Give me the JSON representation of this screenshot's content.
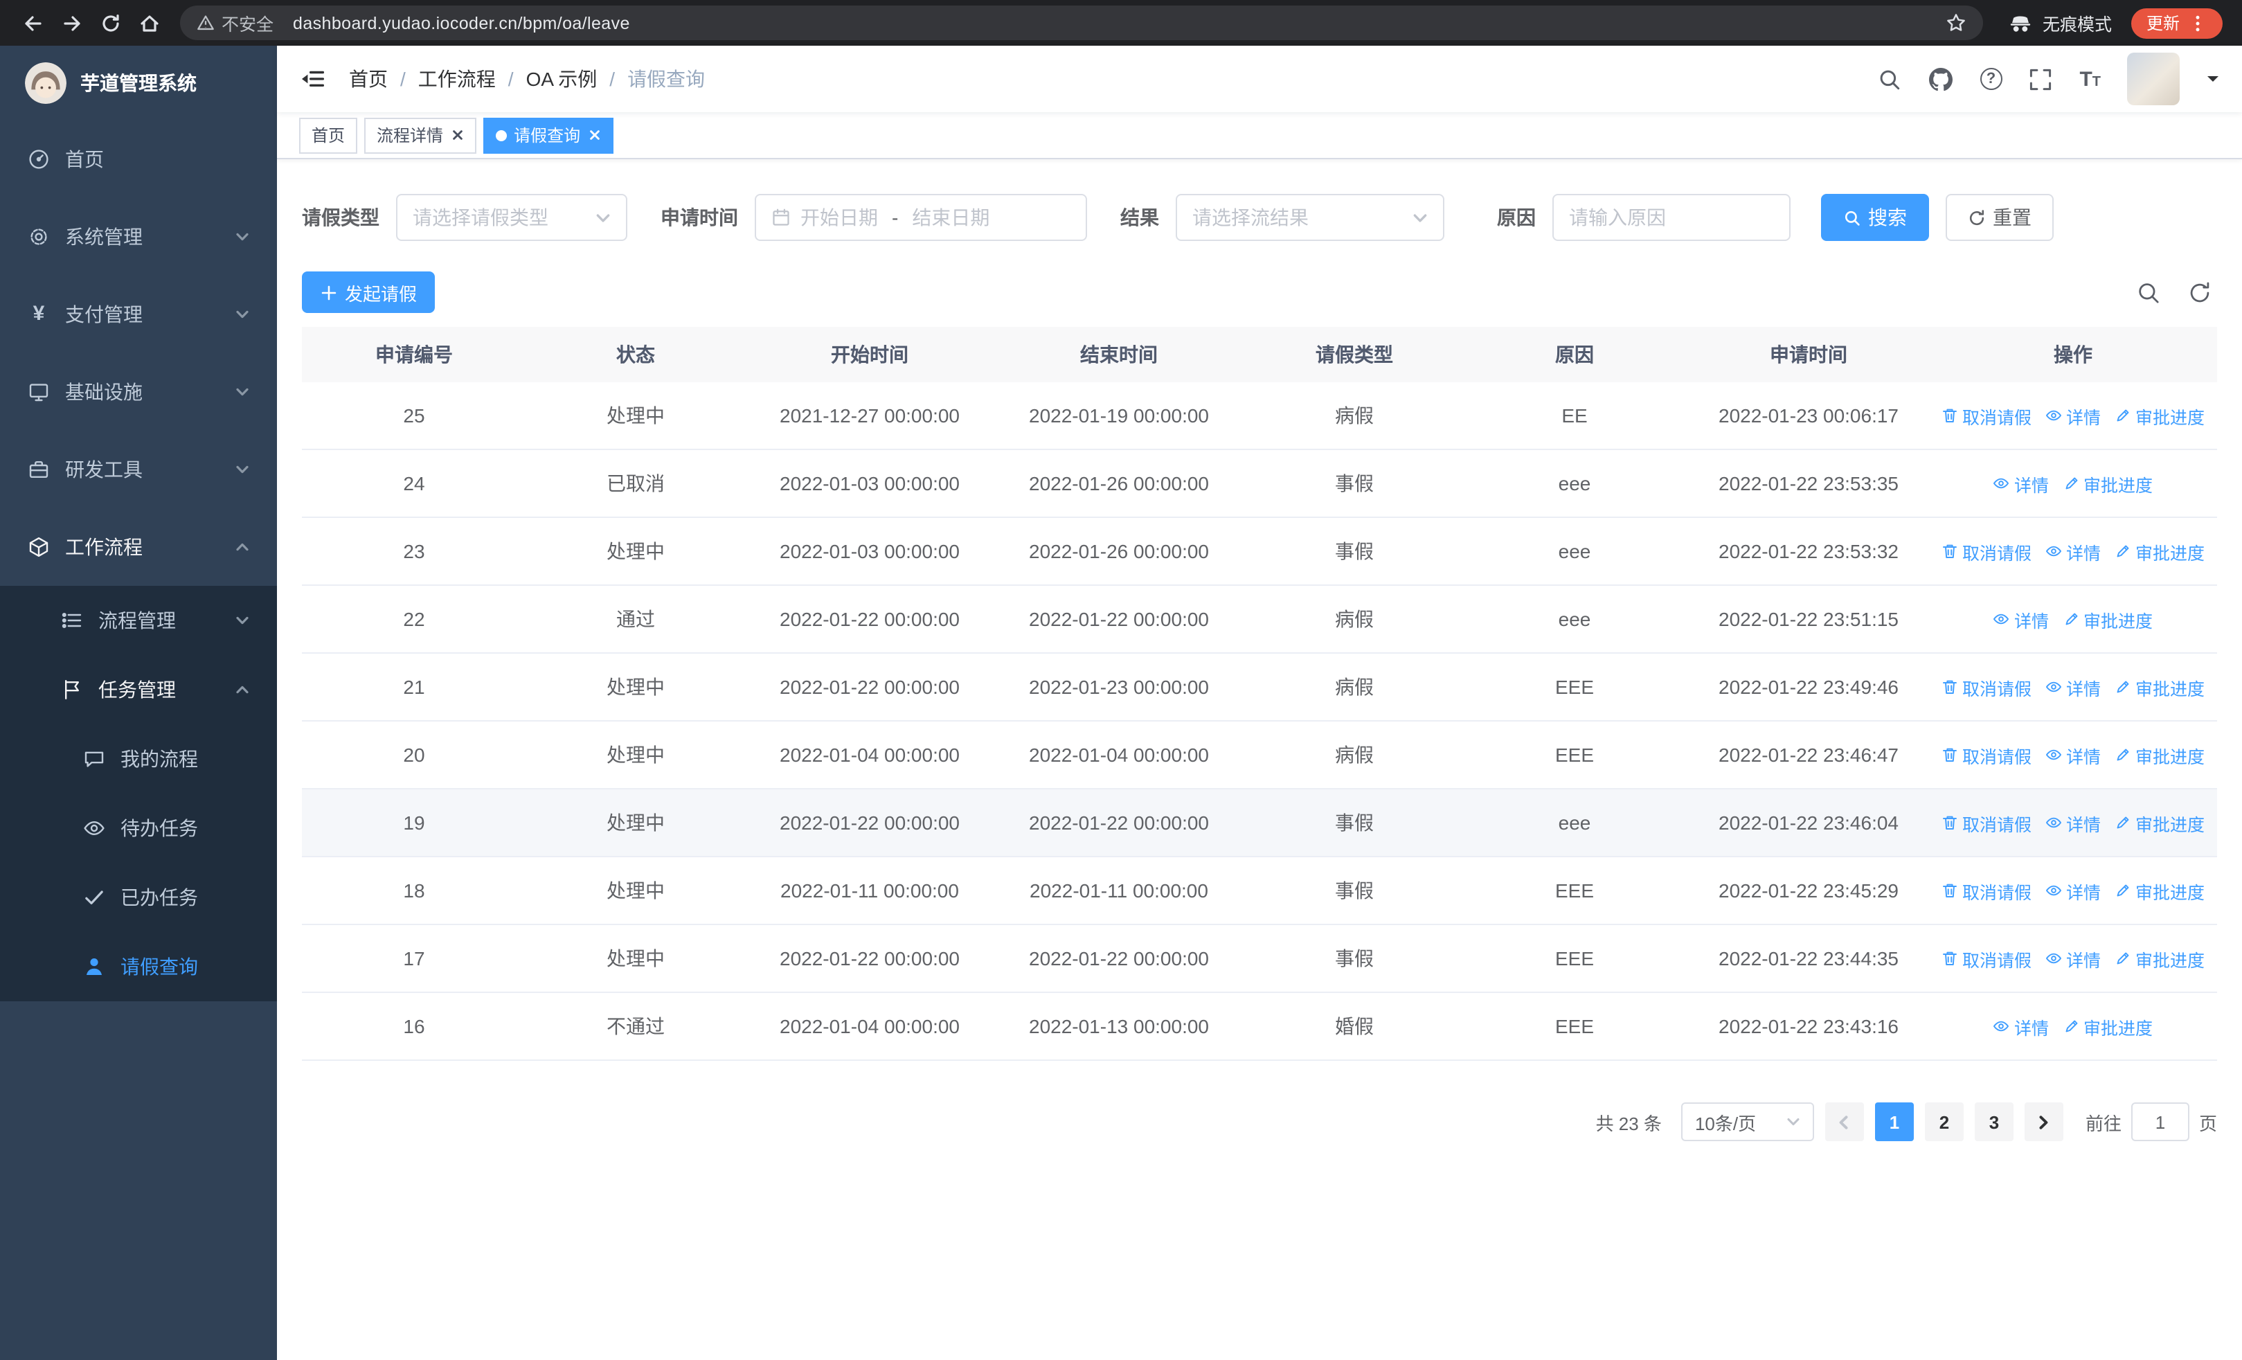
{
  "browser": {
    "security_label": "不安全",
    "url": "dashboard.yudao.iocoder.cn/bpm/oa/leave",
    "incognito_label": "无痕模式",
    "update_label": "更新"
  },
  "sidebar": {
    "app_title": "芋道管理系统",
    "items": [
      {
        "label": "首页",
        "icon": "dashboard-icon",
        "level": 1
      },
      {
        "label": "系统管理",
        "icon": "gear-icon",
        "level": 1,
        "expandable": true
      },
      {
        "label": "支付管理",
        "icon": "payment-icon",
        "level": 1,
        "expandable": true
      },
      {
        "label": "基础设施",
        "icon": "infrastructure-icon",
        "level": 1,
        "expandable": true
      },
      {
        "label": "研发工具",
        "icon": "devtools-icon",
        "level": 1,
        "expandable": true
      },
      {
        "label": "工作流程",
        "icon": "workflow-icon",
        "level": 1,
        "expandable": true,
        "expanded": true
      },
      {
        "label": "流程管理",
        "icon": "process-icon",
        "level": 2,
        "expandable": true
      },
      {
        "label": "任务管理",
        "icon": "task-icon",
        "level": 2,
        "expandable": true,
        "expanded": true
      },
      {
        "label": "我的流程",
        "icon": "chat-icon",
        "level": 3
      },
      {
        "label": "待办任务",
        "icon": "eye-icon",
        "level": 3
      },
      {
        "label": "已办任务",
        "icon": "check-icon",
        "level": 3
      },
      {
        "label": "请假查询",
        "icon": "user-icon",
        "level": 3,
        "active": true
      }
    ]
  },
  "header": {
    "breadcrumb": [
      "首页",
      "工作流程",
      "OA 示例",
      "请假查询"
    ],
    "separator": "/"
  },
  "tabs": [
    {
      "label": "首页",
      "closable": false,
      "active": false
    },
    {
      "label": "流程详情",
      "closable": true,
      "active": false
    },
    {
      "label": "请假查询",
      "closable": true,
      "active": true
    }
  ],
  "filters": {
    "leave_type_label": "请假类型",
    "leave_type_placeholder": "请选择请假类型",
    "apply_time_label": "申请时间",
    "start_date_placeholder": "开始日期",
    "date_separator": "-",
    "end_date_placeholder": "结束日期",
    "result_label": "结果",
    "result_placeholder": "请选择流结果",
    "reason_label": "原因",
    "reason_placeholder": "请输入原因",
    "search_button": "搜索",
    "reset_button": "重置"
  },
  "toolbar": {
    "create_button": "发起请假"
  },
  "table": {
    "columns": [
      "申请编号",
      "状态",
      "开始时间",
      "结束时间",
      "请假类型",
      "原因",
      "申请时间",
      "操作"
    ],
    "ops_labels": {
      "cancel": "取消请假",
      "detail": "详情",
      "progress": "审批进度"
    },
    "rows": [
      {
        "id": "25",
        "status": "处理中",
        "start": "2021-12-27 00:00:00",
        "end": "2022-01-19 00:00:00",
        "type": "病假",
        "reason": "EE",
        "apply_time": "2022-01-23 00:06:17",
        "cancellable": true,
        "highlight": false
      },
      {
        "id": "24",
        "status": "已取消",
        "start": "2022-01-03 00:00:00",
        "end": "2022-01-26 00:00:00",
        "type": "事假",
        "reason": "eee",
        "apply_time": "2022-01-22 23:53:35",
        "cancellable": false,
        "highlight": false
      },
      {
        "id": "23",
        "status": "处理中",
        "start": "2022-01-03 00:00:00",
        "end": "2022-01-26 00:00:00",
        "type": "事假",
        "reason": "eee",
        "apply_time": "2022-01-22 23:53:32",
        "cancellable": true,
        "highlight": false
      },
      {
        "id": "22",
        "status": "通过",
        "start": "2022-01-22 00:00:00",
        "end": "2022-01-22 00:00:00",
        "type": "病假",
        "reason": "eee",
        "apply_time": "2022-01-22 23:51:15",
        "cancellable": false,
        "highlight": false
      },
      {
        "id": "21",
        "status": "处理中",
        "start": "2022-01-22 00:00:00",
        "end": "2022-01-23 00:00:00",
        "type": "病假",
        "reason": "EEE",
        "apply_time": "2022-01-22 23:49:46",
        "cancellable": true,
        "highlight": false
      },
      {
        "id": "20",
        "status": "处理中",
        "start": "2022-01-04 00:00:00",
        "end": "2022-01-04 00:00:00",
        "type": "病假",
        "reason": "EEE",
        "apply_time": "2022-01-22 23:46:47",
        "cancellable": true,
        "highlight": false
      },
      {
        "id": "19",
        "status": "处理中",
        "start": "2022-01-22 00:00:00",
        "end": "2022-01-22 00:00:00",
        "type": "事假",
        "reason": "eee",
        "apply_time": "2022-01-22 23:46:04",
        "cancellable": true,
        "highlight": true
      },
      {
        "id": "18",
        "status": "处理中",
        "start": "2022-01-11 00:00:00",
        "end": "2022-01-11 00:00:00",
        "type": "事假",
        "reason": "EEE",
        "apply_time": "2022-01-22 23:45:29",
        "cancellable": true,
        "highlight": false
      },
      {
        "id": "17",
        "status": "处理中",
        "start": "2022-01-22 00:00:00",
        "end": "2022-01-22 00:00:00",
        "type": "事假",
        "reason": "EEE",
        "apply_time": "2022-01-22 23:44:35",
        "cancellable": true,
        "highlight": false
      },
      {
        "id": "16",
        "status": "不通过",
        "start": "2022-01-04 00:00:00",
        "end": "2022-01-13 00:00:00",
        "type": "婚假",
        "reason": "EEE",
        "apply_time": "2022-01-22 23:43:16",
        "cancellable": false,
        "highlight": false
      }
    ]
  },
  "pagination": {
    "total_text": "共 23 条",
    "page_size": "10条/页",
    "pages": [
      "1",
      "2",
      "3"
    ],
    "active_page": "1",
    "goto_label": "前往",
    "goto_value": "1",
    "goto_suffix": "页"
  },
  "colors": {
    "primary": "#409eff",
    "sidebar_bg": "#304156",
    "submenu_bg": "#1f2d3d"
  }
}
